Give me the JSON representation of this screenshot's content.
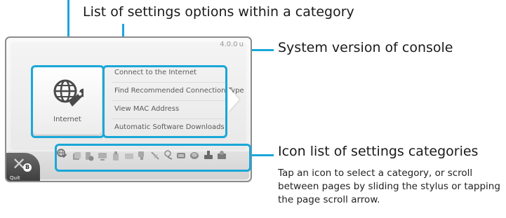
{
  "callouts": {
    "top": "List of settings options within a category",
    "system_version": "System version of console",
    "icon_list": "Icon list of settings categories",
    "icon_list_desc": "Tap an icon to select a category, or scroll between pages by sliding the stylus or tapping the page scroll arrow."
  },
  "screen": {
    "version": "4.0.0",
    "version_icon": "u",
    "category_tile": {
      "label": "Internet",
      "icon": "globe-wrench-icon"
    },
    "options": [
      "Connect to the Internet",
      "Find Recommended Connection Type",
      "View MAC Address",
      "Automatic Software Downloads"
    ],
    "quit": {
      "label": "Quit",
      "button": "B"
    },
    "category_icons": [
      "internet-icon",
      "data-management-icon",
      "parental-controls-icon",
      "tv-icon",
      "power-options-icon",
      "screen-icon",
      "tv-remote-icon",
      "stylus-icon",
      "user-icon",
      "console-icon",
      "storage-icon",
      "system-update-icon",
      "themes-icon"
    ]
  },
  "colors": {
    "accent": "#1aa7d8",
    "screen_bg": "#f1f1f1"
  }
}
